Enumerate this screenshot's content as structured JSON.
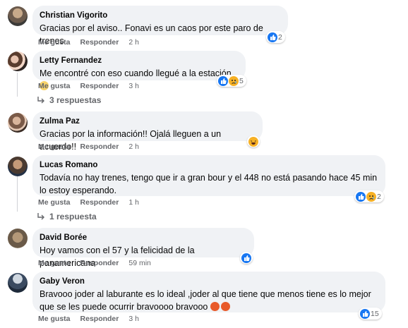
{
  "actions": {
    "like": "Me gusta",
    "reply": "Responder"
  },
  "comments": [
    {
      "author": "Christian Vigorito",
      "text": "Gracias por el aviso.. Fonavi es un caos por este paro de trenes",
      "time": "2 h",
      "reactions_count": "2"
    },
    {
      "author": "Letty Fernandez",
      "text": "Me encontré con eso cuando llegué a la estación",
      "time": "3 h",
      "reactions_count": "5",
      "replies": "3 respuestas"
    },
    {
      "author": "Zulma Paz",
      "text": "Gracias por la información!! Ojalá lleguen a un acuerdo!!",
      "time": "2 h"
    },
    {
      "author": "Lucas Romano",
      "text": "Todavía no hay trenes, tengo que ir a gran bour y el 448 no está pasando hace 45 min lo estoy esperando.",
      "time": "1 h",
      "reactions_count": "2",
      "replies": "1 respuesta"
    },
    {
      "author": "David Borée",
      "text": "Hoy vamos con el 57 y la felicidad de la panamericana",
      "time": "59 min"
    },
    {
      "author": "Gaby Veron",
      "text": "Bravooo joder al laburante es lo ideal ,joder al que tiene que menos tiene es lo mejor que se les puede ocurrir bravoooo bravooo",
      "time": "3 h",
      "reactions_count": "15"
    }
  ],
  "colors": {
    "like": "#1877f2",
    "sad": "#f7b125",
    "angry": "#e9710f",
    "bubble": "#f0f2f5",
    "meta": "#65676b"
  }
}
